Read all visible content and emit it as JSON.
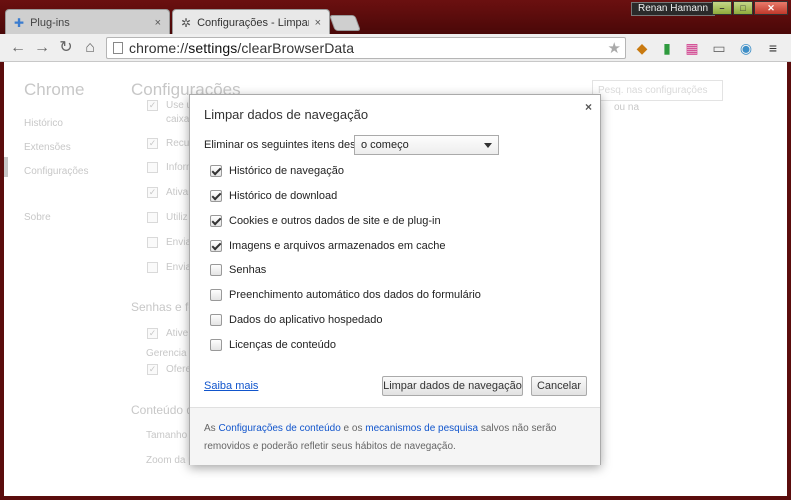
{
  "tabs": [
    {
      "title": "Plug-ins",
      "close": "×",
      "icon": "puzzle-icon"
    },
    {
      "title": "Configurações - Limpar da",
      "close": "×",
      "icon": "gear-icon"
    }
  ],
  "window": {
    "user": "Renan Hamann",
    "minimize": "–",
    "maximize": "□",
    "close": "✕"
  },
  "toolbar": {
    "url_prefix": "chrome://",
    "url_main": "settings",
    "url_suffix": "/clearBrowserData"
  },
  "sidebar": {
    "title": "Chrome",
    "items": [
      "Histórico",
      "Extensões",
      "Configurações",
      "Sobre"
    ]
  },
  "settings": {
    "title": "Configurações",
    "search_placeholder": "Pesq. nas configurações",
    "bg_rows": [
      "Use u",
      "caixa",
      "Recu",
      "Inform",
      "Ativar",
      "Utiliz",
      "Envia",
      "Envia"
    ],
    "bg_section_passwords": "Senhas e fo",
    "bg_pw_rows": [
      "Ative",
      "Gerencia",
      "Ofere"
    ],
    "bg_section_content": "Conteúdo d",
    "bg_content_rows": [
      "Tamanho",
      "Zoom da p"
    ],
    "bg_partial": "ou na"
  },
  "dialog": {
    "title": "Limpar dados de navegação",
    "close": "×",
    "period_label": "Eliminar os seguintes itens desde:",
    "period_value": "o começo",
    "options": [
      {
        "label": "Histórico de navegação",
        "checked": true
      },
      {
        "label": "Histórico de download",
        "checked": true
      },
      {
        "label": "Cookies e outros dados de site e de plug-in",
        "checked": true
      },
      {
        "label": "Imagens e arquivos armazenados em cache",
        "checked": true
      },
      {
        "label": "Senhas",
        "checked": false
      },
      {
        "label": "Preenchimento automático dos dados do formulário",
        "checked": false
      },
      {
        "label": "Dados do aplicativo hospedado",
        "checked": false
      },
      {
        "label": "Licenças de conteúdo",
        "checked": false
      }
    ],
    "learn_more": "Saiba mais",
    "clear_button": "Limpar dados de navegação",
    "cancel_button": "Cancelar",
    "footer": {
      "pre": "As ",
      "link1": "Configurações de conteúdo",
      "mid": " e os ",
      "link2": "mecanismos de pesquisa",
      "post1": " salvos não serão",
      "post2": "removidos e poderão refletir seus hábitos de navegação."
    }
  }
}
